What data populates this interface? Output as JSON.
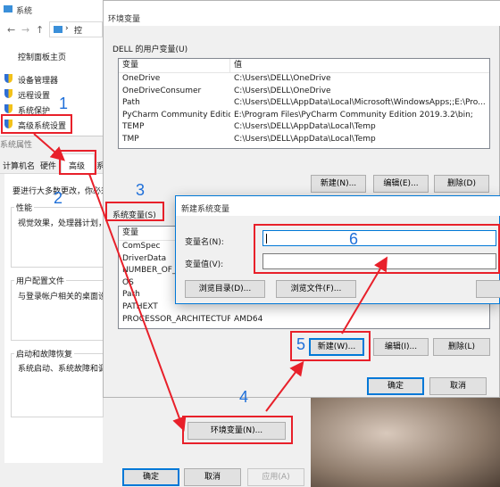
{
  "system": {
    "title": "系统",
    "address_fragment": "控",
    "nav": {
      "home": "控制面板主页",
      "device_manager": "设备管理器",
      "remote": "远程设置",
      "protection": "系统保护",
      "advanced": "高级系统设置"
    }
  },
  "sysprops": {
    "title": "系统属性",
    "tabs": [
      "计算机名",
      "硬件",
      "高级",
      "系"
    ],
    "intro": "要进行大多数更改，你必须",
    "perf_label": "性能",
    "perf_text": "视觉效果，处理器计划，",
    "profile_label": "用户配置文件",
    "profile_text": "与登录帐户相关的桌面设",
    "startup_label": "启动和故障恢复",
    "startup_text": "系统启动、系统故障和调",
    "env_button": "环境变量(N)...",
    "ok": "确定",
    "cancel": "取消",
    "apply": "应用(A)"
  },
  "envvars": {
    "title": "环境变量",
    "user_group": "DELL 的用户变量(U)",
    "col_var": "变量",
    "col_val": "值",
    "user_rows": [
      [
        "OneDrive",
        "C:\\Users\\DELL\\OneDrive"
      ],
      [
        "OneDriveConsumer",
        "C:\\Users\\DELL\\OneDrive"
      ],
      [
        "Path",
        "C:\\Users\\DELL\\AppData\\Local\\Microsoft\\WindowsApps;;E:\\Pro..."
      ],
      [
        "PyCharm Community Edition",
        "E:\\Program Files\\PyCharm Community Edition 2019.3.2\\bin;"
      ],
      [
        "TEMP",
        "C:\\Users\\DELL\\AppData\\Local\\Temp"
      ],
      [
        "TMP",
        "C:\\Users\\DELL\\AppData\\Local\\Temp"
      ]
    ],
    "user_new": "新建(N)...",
    "user_edit": "编辑(E)...",
    "user_delete": "删除(D)",
    "sys_group": "系统变量(S)",
    "sys_rows": [
      [
        "ComSpec",
        ""
      ],
      [
        "DriverData",
        ""
      ],
      [
        "NUMBER_OF_P",
        ""
      ],
      [
        "OS",
        ""
      ],
      [
        "Path",
        ""
      ],
      [
        "PATHEXT",
        ""
      ],
      [
        "PROCESSOR_ARCHITECTURE",
        "AMD64"
      ]
    ],
    "sys_new": "新建(W)...",
    "sys_edit": "编辑(I)...",
    "sys_delete": "删除(L)",
    "ok": "确定",
    "cancel": "取消"
  },
  "newvar": {
    "title": "新建系统变量",
    "name_label": "变量名(N):",
    "value_label": "变量值(V):",
    "browse_dir": "浏览目录(D)...",
    "browse_file": "浏览文件(F)..."
  },
  "steps": [
    "1",
    "2",
    "3",
    "4",
    "5",
    "6"
  ],
  "colors": {
    "annotation_red": "#e8202a",
    "step_blue": "#1e6fd9",
    "focus_blue": "#0078d7"
  }
}
